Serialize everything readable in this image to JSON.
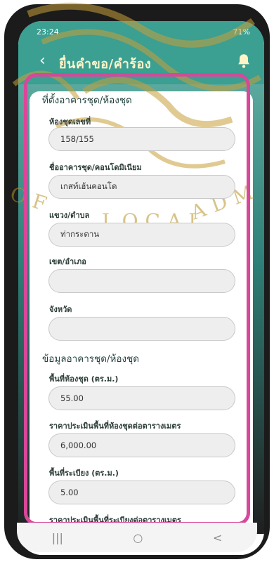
{
  "status_bar": {
    "time": "23:24",
    "battery": "71%"
  },
  "app_bar": {
    "title": "ยื่นคำขอ/คำร้อง",
    "back_icon": "arrow-left-icon",
    "bell_icon": "bell-icon"
  },
  "watermark": {
    "text_left": "OF",
    "text_center": "LOCAL",
    "text_right": "ADM"
  },
  "form": {
    "section_location": "ที่ตั้งอาคารชุด/ห้องชุด",
    "room_number_label": "ห้องชุดเลขที่",
    "room_number_value": "158/155",
    "building_name_label": "ชื่ออาคารชุด/คอนโดมิเนียม",
    "building_name_value": "เกสท์เฮ้นคอนโด",
    "subdistrict_label": "แขวง/ตำบล",
    "subdistrict_value": "ท่ากระดาน",
    "district_label": "เขต/อำเภอ",
    "district_value": "",
    "province_label": "จังหวัด",
    "province_value": "",
    "section_info": "ข้อมูลอาคารชุด/ห้องชุด",
    "room_area_label": "พื้นที่ห้องชุด (ตร.ม.)",
    "room_area_value": "55.00",
    "room_price_label": "ราคาประเมินพื้นที่ห้องชุดต่อตารางเมตร",
    "room_price_value": "6,000.00",
    "balcony_area_label": "พื้นที่ระเบียง (ตร.ม.)",
    "balcony_area_value": "5.00",
    "balcony_price_label": "ราคาประเมินพื้นที่ระเบียงต่อตารางเมตร"
  },
  "nav": {
    "recent": "|||",
    "home": "○",
    "back": "<"
  },
  "colors": {
    "header": "#3b9f92",
    "highlight": "#d9479a"
  }
}
